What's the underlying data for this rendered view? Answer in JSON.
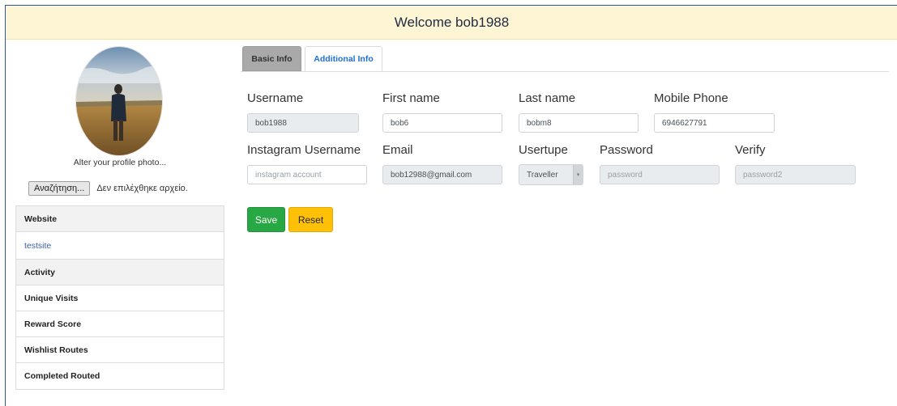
{
  "header": {
    "welcome": "Welcome bob1988"
  },
  "sidebar": {
    "alter_text": "Alter your profile photo...",
    "file_button": "Αναζήτηση...",
    "file_status": "Δεν επιλέχθηκε αρχείο.",
    "website_header": "Website",
    "website_link": "testsite",
    "items": [
      "Activity",
      "Unique Visits",
      "Reward Score",
      "Wishlist Routes",
      "Completed Routed"
    ]
  },
  "tabs": {
    "basic": "Basic Info",
    "additional": "Additional Info"
  },
  "form": {
    "username_label": "Username",
    "username_value": "bob1988",
    "firstname_label": "First name",
    "firstname_value": "bob6",
    "lastname_label": "Last name",
    "lastname_value": "bobm8",
    "mobile_label": "Mobile Phone",
    "mobile_value": "6946627791",
    "instagram_label": "Instagram Username",
    "instagram_placeholder": "instagram account",
    "email_label": "Email",
    "email_value": "bob12988@gmail.com",
    "usertype_label": "Usertupe",
    "usertype_value": "Traveller",
    "password_label": "Password",
    "password_value": "password",
    "verify_label": "Verify",
    "verify_value": "password2",
    "save_label": "Save",
    "reset_label": "Reset"
  },
  "colors": {
    "header_bg": "#fdf5d4",
    "save": "#28a745",
    "reset": "#ffc107",
    "tab_active": "#1f6fd6"
  }
}
